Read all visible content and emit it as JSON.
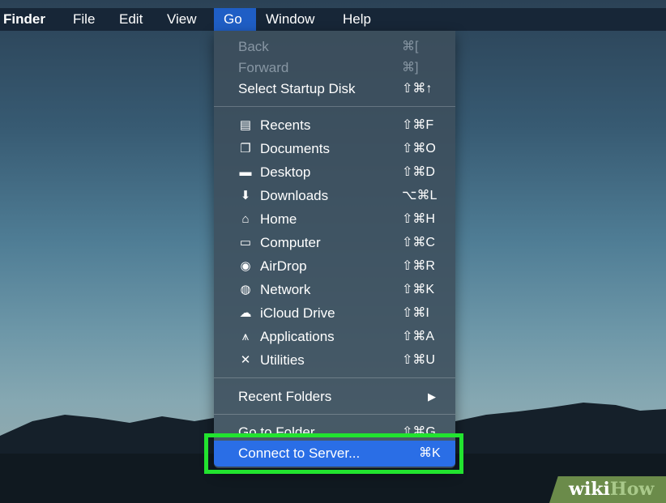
{
  "menubar": {
    "items": [
      "Finder",
      "File",
      "Edit",
      "View",
      "Go",
      "Window",
      "Help"
    ],
    "selected": "Go"
  },
  "go_menu": {
    "history": [
      {
        "label": "Back",
        "shortcut": "⌘[",
        "enabled": false
      },
      {
        "label": "Forward",
        "shortcut": "⌘]",
        "enabled": false
      },
      {
        "label": "Select Startup Disk",
        "shortcut": "⇧⌘↑",
        "enabled": true
      }
    ],
    "places": [
      {
        "label": "Recents",
        "shortcut": "⇧⌘F",
        "icon": "recents-icon"
      },
      {
        "label": "Documents",
        "shortcut": "⇧⌘O",
        "icon": "documents-icon"
      },
      {
        "label": "Desktop",
        "shortcut": "⇧⌘D",
        "icon": "desktop-icon"
      },
      {
        "label": "Downloads",
        "shortcut": "⌥⌘L",
        "icon": "downloads-icon"
      },
      {
        "label": "Home",
        "shortcut": "⇧⌘H",
        "icon": "home-icon"
      },
      {
        "label": "Computer",
        "shortcut": "⇧⌘C",
        "icon": "computer-icon"
      },
      {
        "label": "AirDrop",
        "shortcut": "⇧⌘R",
        "icon": "airdrop-icon"
      },
      {
        "label": "Network",
        "shortcut": "⇧⌘K",
        "icon": "network-icon"
      },
      {
        "label": "iCloud Drive",
        "shortcut": "⇧⌘I",
        "icon": "icloud-icon"
      },
      {
        "label": "Applications",
        "shortcut": "⇧⌘A",
        "icon": "applications-icon"
      },
      {
        "label": "Utilities",
        "shortcut": "⇧⌘U",
        "icon": "utilities-icon"
      }
    ],
    "recent_folders": {
      "label": "Recent Folders",
      "shortcut": "▶"
    },
    "go_to_folder": {
      "label": "Go to Folder...",
      "shortcut": "⇧⌘G"
    },
    "connect_to_server": {
      "label": "Connect to Server...",
      "shortcut": "⌘K"
    }
  },
  "colors": {
    "selection": "#2a6ee6",
    "highlight_box": "#22e32f",
    "menu_bg": "#3e4e5c"
  },
  "watermark": {
    "part1": "wiki",
    "part2": "How"
  }
}
